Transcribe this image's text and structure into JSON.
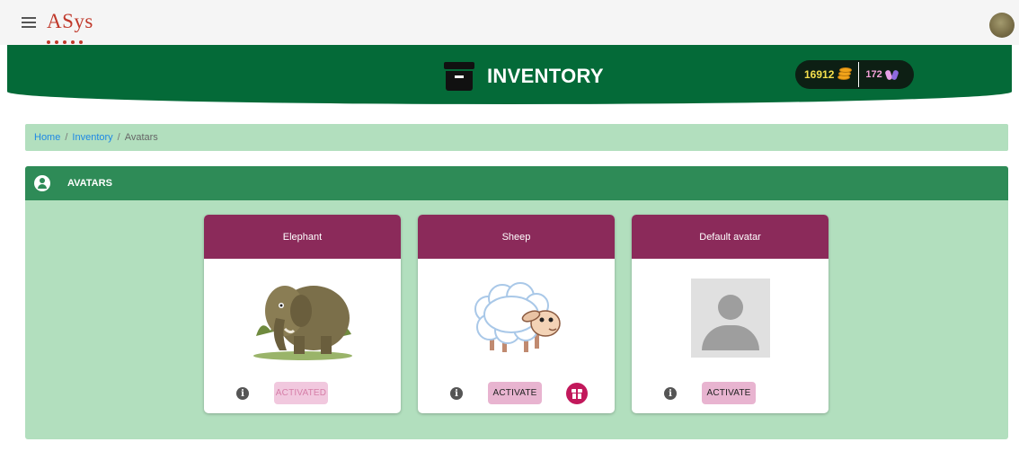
{
  "app": {
    "brand": "ASys"
  },
  "header": {
    "title": "INVENTORY",
    "coins": "16912",
    "gems": "172"
  },
  "breadcrumb": {
    "home": "Home",
    "inventory": "Inventory",
    "current": "Avatars",
    "separator": "/"
  },
  "section": {
    "title": "AVATARS"
  },
  "cards": [
    {
      "title": "Elephant",
      "button": "ACTIVATED",
      "button_disabled": true,
      "has_gift": false,
      "image": "elephant-image"
    },
    {
      "title": "Sheep",
      "button": "ACTIVATE",
      "button_disabled": false,
      "has_gift": true,
      "image": "sheep-image"
    },
    {
      "title": "Default avatar",
      "button": "ACTIVATE",
      "button_disabled": false,
      "has_gift": false,
      "image": "default-avatar-image"
    }
  ],
  "colors": {
    "header": "#046a38",
    "section_header": "#2e8b57",
    "panel": "#b2dfbe",
    "card_header": "#8b2a5a",
    "button": "#e8b4d0",
    "gift": "#c2185b",
    "brand": "#c0392b"
  },
  "icons": [
    "menu-icon",
    "inventory-box-icon",
    "coin-icon",
    "gem-icon",
    "user-circle-icon",
    "info-icon",
    "gift-icon"
  ]
}
